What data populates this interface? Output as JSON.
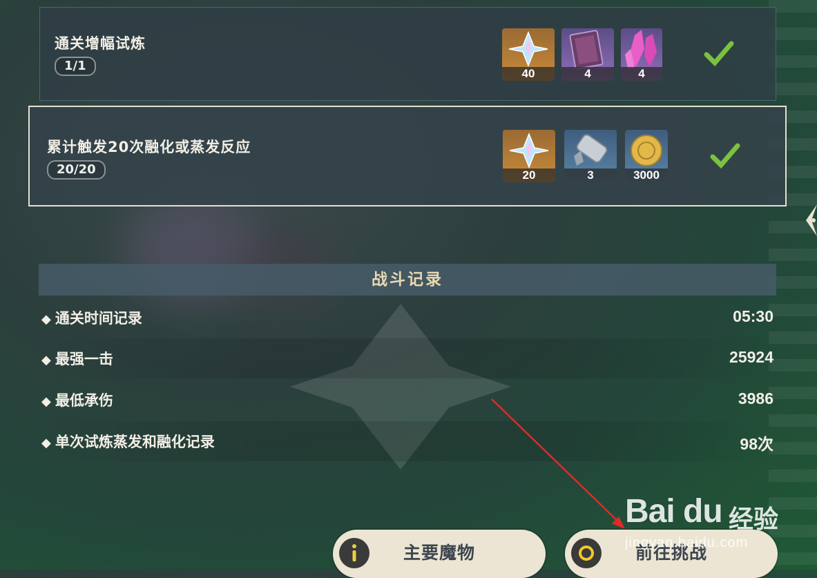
{
  "tasks": [
    {
      "title": "通关增幅试炼",
      "progress": "1/1",
      "rewards": [
        {
          "icon": "primogem-icon",
          "qty": "40"
        },
        {
          "icon": "hero-wit-book-icon",
          "qty": "4"
        },
        {
          "icon": "crystal-icon",
          "qty": "4"
        }
      ]
    },
    {
      "title": "累计触发20次融化或蒸发反应",
      "progress": "20/20",
      "rewards": [
        {
          "icon": "primogem-icon",
          "qty": "20"
        },
        {
          "icon": "mystic-enhancement-ore-icon",
          "qty": "3"
        },
        {
          "icon": "mora-coin-icon",
          "qty": "3000"
        }
      ]
    }
  ],
  "record": {
    "header": "战斗记录",
    "rows": [
      {
        "label": "通关时间记录",
        "value": "05:30"
      },
      {
        "label": "最强一击",
        "value": "25924"
      },
      {
        "label": "最低承伤",
        "value": "3986"
      },
      {
        "label": "单次试炼蒸发和融化记录",
        "value": "98次"
      }
    ]
  },
  "buttons": {
    "main_monsters": "主要魔物",
    "go_challenge": "前往挑战"
  },
  "watermark": {
    "logo": "Bai du",
    "cn": "经验",
    "url": "jingyan.baidu.com"
  },
  "colors": {
    "accent_gold": "#e9d9b1",
    "check_green": "#7cc23d"
  }
}
